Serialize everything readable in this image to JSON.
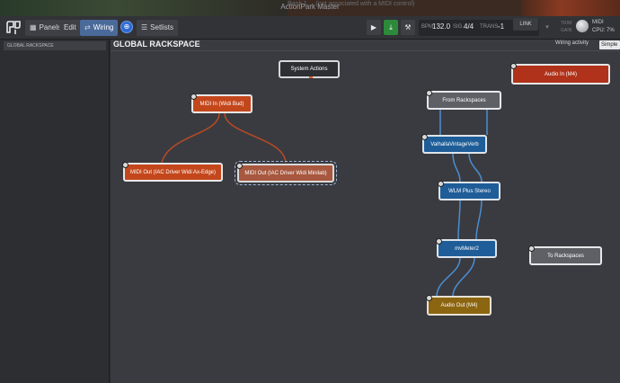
{
  "window": {
    "title": "ActionPark Master",
    "ghost_text": "Bank 1 ... (not associated with a MIDI control)"
  },
  "toolbar": {
    "panels": "Panels",
    "edit": "Edit",
    "wiring": "Wiring",
    "setlists": "Setlists",
    "bpm_label": "BPM",
    "bpm_value": "132.0",
    "sig_label": "SIG.",
    "sig_value": "4/4",
    "trans_label": "TRANS.",
    "trans_value": "-1",
    "link": "LINK",
    "trim_label": "TRIM",
    "gain_label": "GAIN",
    "midi_label": "MIDI",
    "cpu_label": "CPU:",
    "cpu_value": "7%"
  },
  "sidebar": {
    "items": [
      {
        "label": "GLOBAL RACKSPACE"
      }
    ]
  },
  "canvas": {
    "title": "GLOBAL RACKSPACE",
    "wiring_activity": "Wiring activity",
    "view_mode": "Simple"
  },
  "blocks": {
    "system_actions": "System Actions",
    "midi_in": "MIDI In (Widi Bud)",
    "midi_out_ax": "MIDI Out (IAC Driver Widi Ax-Edge)",
    "midi_out_minilab": "MIDI Out (IAC Driver Widi Minilab)",
    "audio_in": "Audio In (M4)",
    "from_rackspaces": "From Rackspaces",
    "valhalla": "ValhallaVintageVerb",
    "wlm": "WLM Plus Stereo",
    "mvmeter": "mvMeter2",
    "audio_out": "Audio Out (M4)",
    "to_rackspaces": "To Rackspaces"
  },
  "colors": {
    "accent_blue": "#2f6bd4",
    "midi_orange": "#c4471c",
    "plugin_blue": "#1f5d98",
    "audio_gold": "#8c6510",
    "audio_in_red": "#b0321a",
    "wire_orange": "#b94a24",
    "wire_blue": "#4a8ed4"
  }
}
